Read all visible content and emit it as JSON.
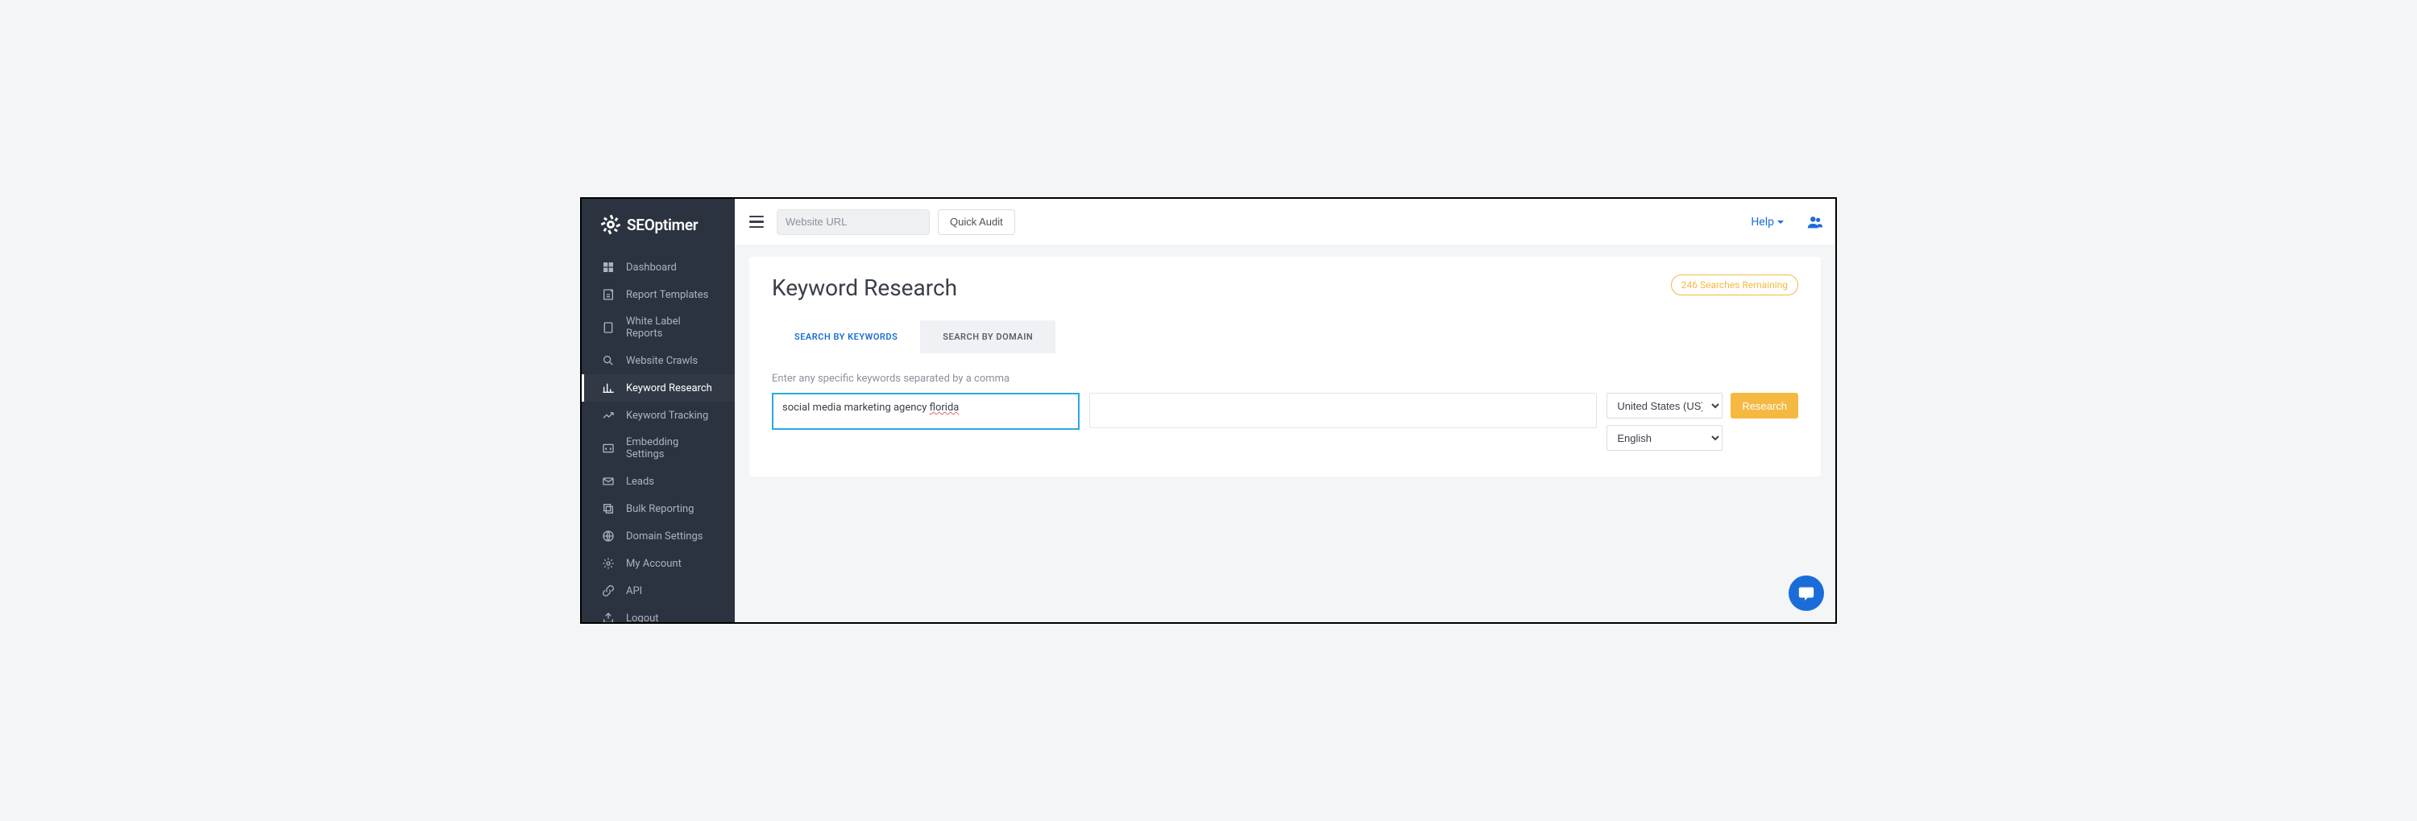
{
  "logo": {
    "text": "SEOptimer"
  },
  "sidebar": {
    "items": [
      {
        "label": "Dashboard",
        "icon": "dashboard-icon"
      },
      {
        "label": "Report Templates",
        "icon": "template-icon"
      },
      {
        "label": "White Label Reports",
        "icon": "document-icon"
      },
      {
        "label": "Website Crawls",
        "icon": "search-icon"
      },
      {
        "label": "Keyword Research",
        "icon": "chart-icon"
      },
      {
        "label": "Keyword Tracking",
        "icon": "trend-icon"
      },
      {
        "label": "Embedding Settings",
        "icon": "code-icon"
      },
      {
        "label": "Leads",
        "icon": "mail-icon"
      },
      {
        "label": "Bulk Reporting",
        "icon": "stack-icon"
      },
      {
        "label": "Domain Settings",
        "icon": "globe-icon"
      },
      {
        "label": "My Account",
        "icon": "gear-icon"
      },
      {
        "label": "API",
        "icon": "link-icon"
      },
      {
        "label": "Logout",
        "icon": "logout-icon"
      }
    ],
    "active_index": 4
  },
  "topbar": {
    "url_placeholder": "Website URL",
    "quick_audit_label": "Quick Audit",
    "help_label": "Help"
  },
  "page": {
    "title": "Keyword Research",
    "searches_remaining": "246 Searches Remaining",
    "tabs": [
      {
        "label": "SEARCH BY KEYWORDS"
      },
      {
        "label": "SEARCH BY DOMAIN"
      }
    ],
    "active_tab": 0,
    "form_hint": "Enter any specific keywords separated by a comma",
    "keywords_value_prefix": "social media marketing agency ",
    "keywords_value_misspelled": "florida",
    "country_selected": "United States (US)",
    "language_selected": "English",
    "research_label": "Research"
  }
}
